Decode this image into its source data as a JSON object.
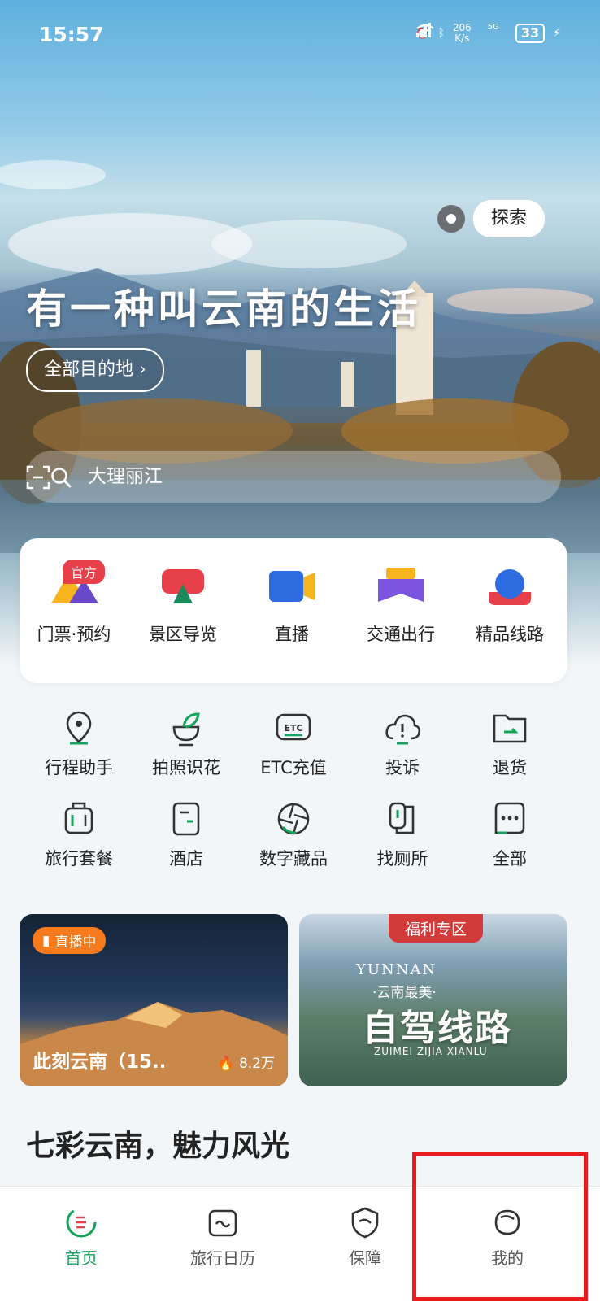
{
  "status_bar": {
    "time": "15:57",
    "speed_value": "206",
    "speed_unit": "K/s",
    "network": "5G",
    "battery": "33"
  },
  "hero": {
    "explore_label": "探索",
    "title": "有一种叫云南的生活",
    "destinations_label": "全部目的地 ›",
    "search_placeholder": "大理丽江"
  },
  "main_services": [
    {
      "label": "门票·预约",
      "icon": "ticket-icon",
      "badge": "官方"
    },
    {
      "label": "景区导览",
      "icon": "scenic-guide-icon"
    },
    {
      "label": "直播",
      "icon": "live-camera-icon"
    },
    {
      "label": "交通出行",
      "icon": "transport-icon"
    },
    {
      "label": "精品线路",
      "icon": "route-icon"
    }
  ],
  "tools": [
    {
      "label": "行程助手",
      "icon": "location-pin-icon"
    },
    {
      "label": "拍照识花",
      "icon": "flower-icon"
    },
    {
      "label": "ETC充值",
      "icon": "etc-icon"
    },
    {
      "label": "投诉",
      "icon": "complaint-cloud-icon"
    },
    {
      "label": "退货",
      "icon": "return-folder-icon"
    },
    {
      "label": "旅行套餐",
      "icon": "luggage-icon"
    },
    {
      "label": "酒店",
      "icon": "hotel-icon"
    },
    {
      "label": "数字藏品",
      "icon": "aperture-icon"
    },
    {
      "label": "找厕所",
      "icon": "toilet-icon"
    },
    {
      "label": "全部",
      "icon": "more-dots-icon"
    }
  ],
  "promos": {
    "live": {
      "badge": "直播中",
      "title": "此刻云南（15..",
      "viewers": "8.2万"
    },
    "welfare": {
      "badge": "福利专区",
      "en_title": "YUNNAN",
      "cn_sub": "·云南最美·",
      "big_title": "自驾线路",
      "pinyin": "ZUIMEI ZIJIA XIANLU"
    }
  },
  "section_title": "七彩云南，魅力风光",
  "nav": [
    {
      "label": "首页",
      "icon": "home-icon",
      "active": true
    },
    {
      "label": "旅行日历",
      "icon": "calendar-icon",
      "active": false
    },
    {
      "label": "保障",
      "icon": "shield-icon",
      "active": false
    },
    {
      "label": "我的",
      "icon": "profile-icon",
      "active": false
    }
  ],
  "colors": {
    "accent": "#14a35a",
    "badge_red": "#e8404b",
    "live_orange": "#f77b1c",
    "highlight_box": "#ea1b1b"
  }
}
